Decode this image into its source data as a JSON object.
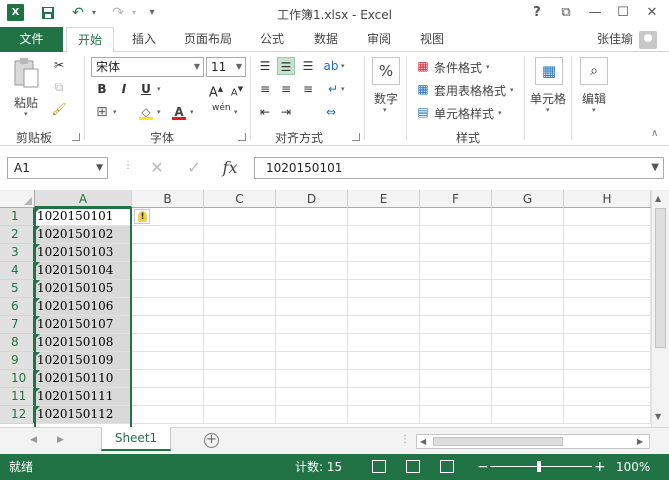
{
  "window": {
    "title": "工作簿1.xlsx - Excel",
    "help": "?",
    "ribbon_display": "⧉",
    "minimize": "—",
    "restore": "☐",
    "close": "✕"
  },
  "qat": {
    "app_logo": "X",
    "save_icon": "save-icon",
    "undo_icon": "undo-icon",
    "redo_icon": "redo-icon",
    "customize_icon": "chevron-down-icon"
  },
  "tabs": {
    "file": "文件",
    "items": [
      {
        "label": "开始",
        "active": true
      },
      {
        "label": "插入",
        "active": false
      },
      {
        "label": "页面布局",
        "active": false
      },
      {
        "label": "公式",
        "active": false
      },
      {
        "label": "数据",
        "active": false
      },
      {
        "label": "审阅",
        "active": false
      },
      {
        "label": "视图",
        "active": false
      }
    ],
    "user_name": "张佳瑜"
  },
  "ribbon": {
    "clipboard": {
      "paste_label": "粘贴",
      "group_label": "剪贴板"
    },
    "font": {
      "font_name": "宋体",
      "font_size": "11",
      "bold": "B",
      "italic": "I",
      "underline": "U",
      "font_color_letter": "A",
      "wen_label": "wén",
      "group_label": "字体"
    },
    "alignment": {
      "group_label": "对齐方式"
    },
    "number": {
      "label": "数字",
      "percent": "%"
    },
    "styles": {
      "conditional": "条件格式",
      "table_format": "套用表格格式",
      "cell_styles": "单元格样式",
      "group_label": "样式"
    },
    "cells": {
      "label": "单元格"
    },
    "editing": {
      "label": "编辑"
    }
  },
  "formula_bar": {
    "name_box": "A1",
    "cancel": "✕",
    "enter": "✓",
    "fx": "fx",
    "content": "1020150101"
  },
  "grid": {
    "columns": [
      "A",
      "B",
      "C",
      "D",
      "E",
      "F",
      "G",
      "H"
    ],
    "rows": [
      "1",
      "2",
      "3",
      "4",
      "5",
      "6",
      "7",
      "8",
      "9",
      "10",
      "11",
      "12"
    ],
    "column_a_values": [
      "1020150101",
      "1020150102",
      "1020150103",
      "1020150104",
      "1020150105",
      "1020150106",
      "1020150107",
      "1020150108",
      "1020150109",
      "1020150110",
      "1020150111",
      "1020150112"
    ],
    "selected_column": "A"
  },
  "sheets": {
    "tabs": [
      "Sheet1"
    ],
    "add": "+"
  },
  "status": {
    "ready": "就绪",
    "count": "计数: 15",
    "zoom_minus": "−",
    "zoom_plus": "+",
    "zoom": "100%"
  },
  "colors": {
    "accent": "#217346",
    "selection_fill": "#d9d9d9",
    "header_bg": "#f3f3f3"
  }
}
